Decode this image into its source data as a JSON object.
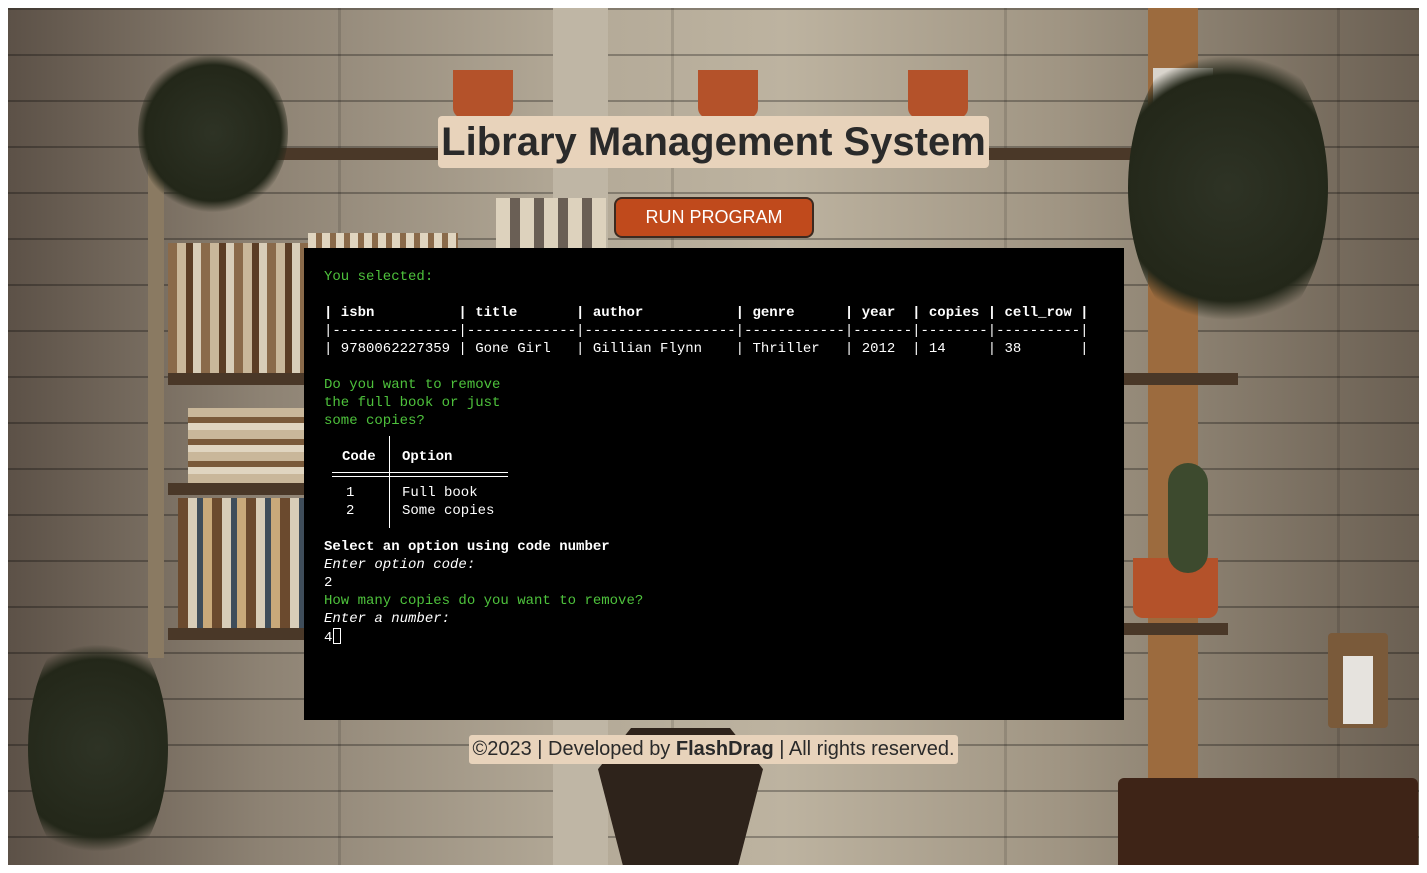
{
  "header": {
    "title": "Library Management System"
  },
  "toolbar": {
    "run_label": "RUN PROGRAM"
  },
  "terminal": {
    "you_selected": "You selected:",
    "book_table": {
      "header_row": "| isbn          | title       | author           | genre      | year  | copies | cell_row |",
      "rule_row": "|---------------|-------------|------------------|------------|-------|--------|----------|",
      "data_row": "| 9780062227359 | Gone Girl   | Gillian Flynn    | Thriller   | 2012  | 14     | 38       |"
    },
    "question_lines": [
      "Do you want to remove",
      "the full book or just",
      "some copies?"
    ],
    "option_table": {
      "headers": [
        "Code",
        "Option"
      ],
      "rows": [
        {
          "code": "1",
          "option": "Full book"
        },
        {
          "code": "2",
          "option": "Some copies"
        }
      ]
    },
    "select_prompt": "Select an option using code number",
    "enter_option": "Enter option code:",
    "option_input": "2",
    "copies_question": "How many copies do you want to remove?",
    "enter_number": "Enter a number:",
    "number_input": "4"
  },
  "footer": {
    "prefix": "©2023 | Developed by ",
    "author": "FlashDrag",
    "suffix": " | All rights reserved."
  },
  "colors": {
    "accent_button": "#c04a1c",
    "banner_bg": "#e8d3bb",
    "terminal_bg": "#000000",
    "terminal_green": "#4ec23c"
  }
}
